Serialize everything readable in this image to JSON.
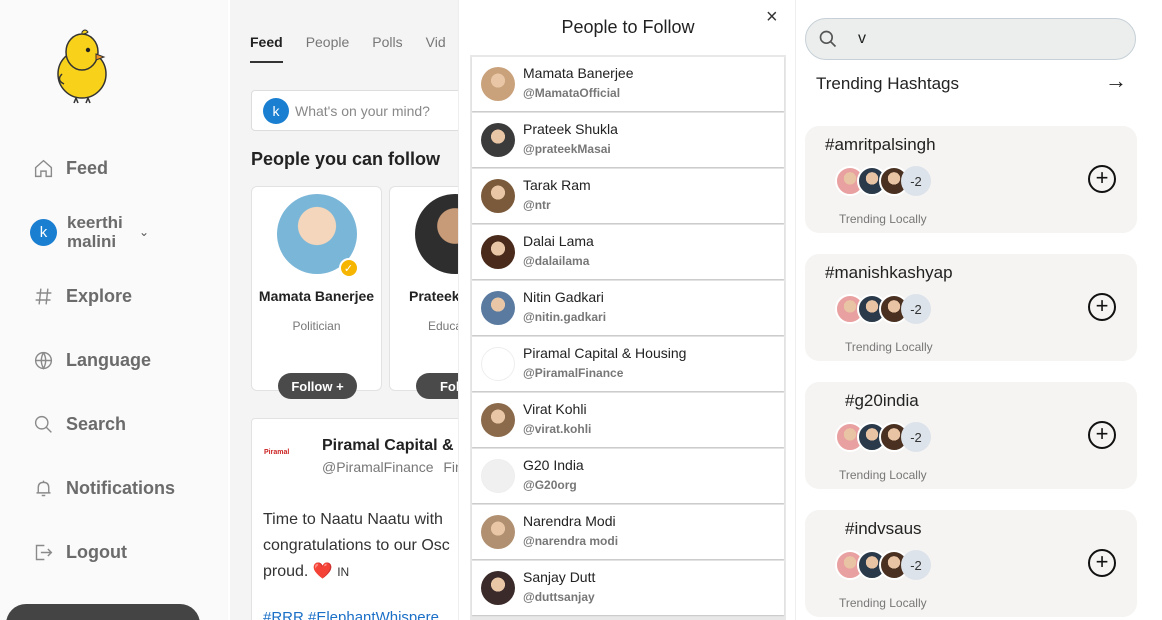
{
  "sidebar": {
    "nav": [
      {
        "label": "Feed",
        "icon": "home-icon"
      },
      {
        "label": "Explore",
        "icon": "hashtag-icon"
      },
      {
        "label": "Language",
        "icon": "globe-icon"
      },
      {
        "label": "Search",
        "icon": "search-icon"
      },
      {
        "label": "Notifications",
        "icon": "bell-icon"
      },
      {
        "label": "Logout",
        "icon": "logout-icon"
      }
    ],
    "user": {
      "initial": "k",
      "name": "keerthi malini"
    }
  },
  "feed": {
    "tabs": [
      "Feed",
      "People",
      "Polls",
      "Vid"
    ],
    "composer_placeholder": "What's on your mind?",
    "composer_initial": "k",
    "section_title": "People you can follow",
    "suggestions": [
      {
        "name": "Mamata Banerjee",
        "role": "Politician",
        "follow": "Follow +"
      },
      {
        "name": "Prateek Shukla",
        "role": "Educa",
        "follow": "Follo"
      }
    ],
    "post": {
      "logo_text": "Piramal",
      "author": "Piramal Capital & H",
      "handle": "@PiramalFinance",
      "handle_suffix": "Fin",
      "body_1": "Time to Naatu Naatu with",
      "body_2": "congratulations to our Osc",
      "body_3": "proud. ❤️",
      "body_3_tail": "IN",
      "tags": "#RRR #ElephantWhispere"
    }
  },
  "modal": {
    "title": "People to Follow",
    "close": "×",
    "people": [
      {
        "name": "Mamata Banerjee",
        "handle": "@MamataOfficial",
        "color": "#c9a27b"
      },
      {
        "name": "Prateek Shukla",
        "handle": "@prateekMasai",
        "color": "#3b3b3b"
      },
      {
        "name": "Tarak Ram",
        "handle": "@ntr",
        "color": "#7a5a3a"
      },
      {
        "name": "Dalai Lama",
        "handle": "@dalailama",
        "color": "#4a2a1a"
      },
      {
        "name": "Nitin Gadkari",
        "handle": "@nitin.gadkari",
        "color": "#5a7aa0"
      },
      {
        "name": "Piramal Capital & Housing",
        "handle": "@PiramalFinance",
        "color": "#ffffff"
      },
      {
        "name": "Virat Kohli",
        "handle": "@virat.kohli",
        "color": "#8a6a4a"
      },
      {
        "name": "G20 India",
        "handle": "@G20org",
        "color": "#f0f0f0"
      },
      {
        "name": "Narendra Modi",
        "handle": "@narendra modi",
        "color": "#b09070"
      },
      {
        "name": "Sanjay Dutt",
        "handle": "@duttsanjay",
        "color": "#3a2a2a"
      }
    ]
  },
  "right": {
    "search_value": "v",
    "trending_title": "Trending Hashtags",
    "arrow": "→",
    "hashtags": [
      {
        "tag": "#amritpalsingh",
        "count": "-2",
        "location": "Trending Locally"
      },
      {
        "tag": "#manishkashyap",
        "count": "-2",
        "location": "Trending Locally"
      },
      {
        "tag": "#g20india",
        "count": "-2",
        "location": "Trending Locally"
      },
      {
        "tag": "#indvsaus",
        "count": "-2",
        "location": "Trending Locally"
      }
    ],
    "add": "+"
  }
}
